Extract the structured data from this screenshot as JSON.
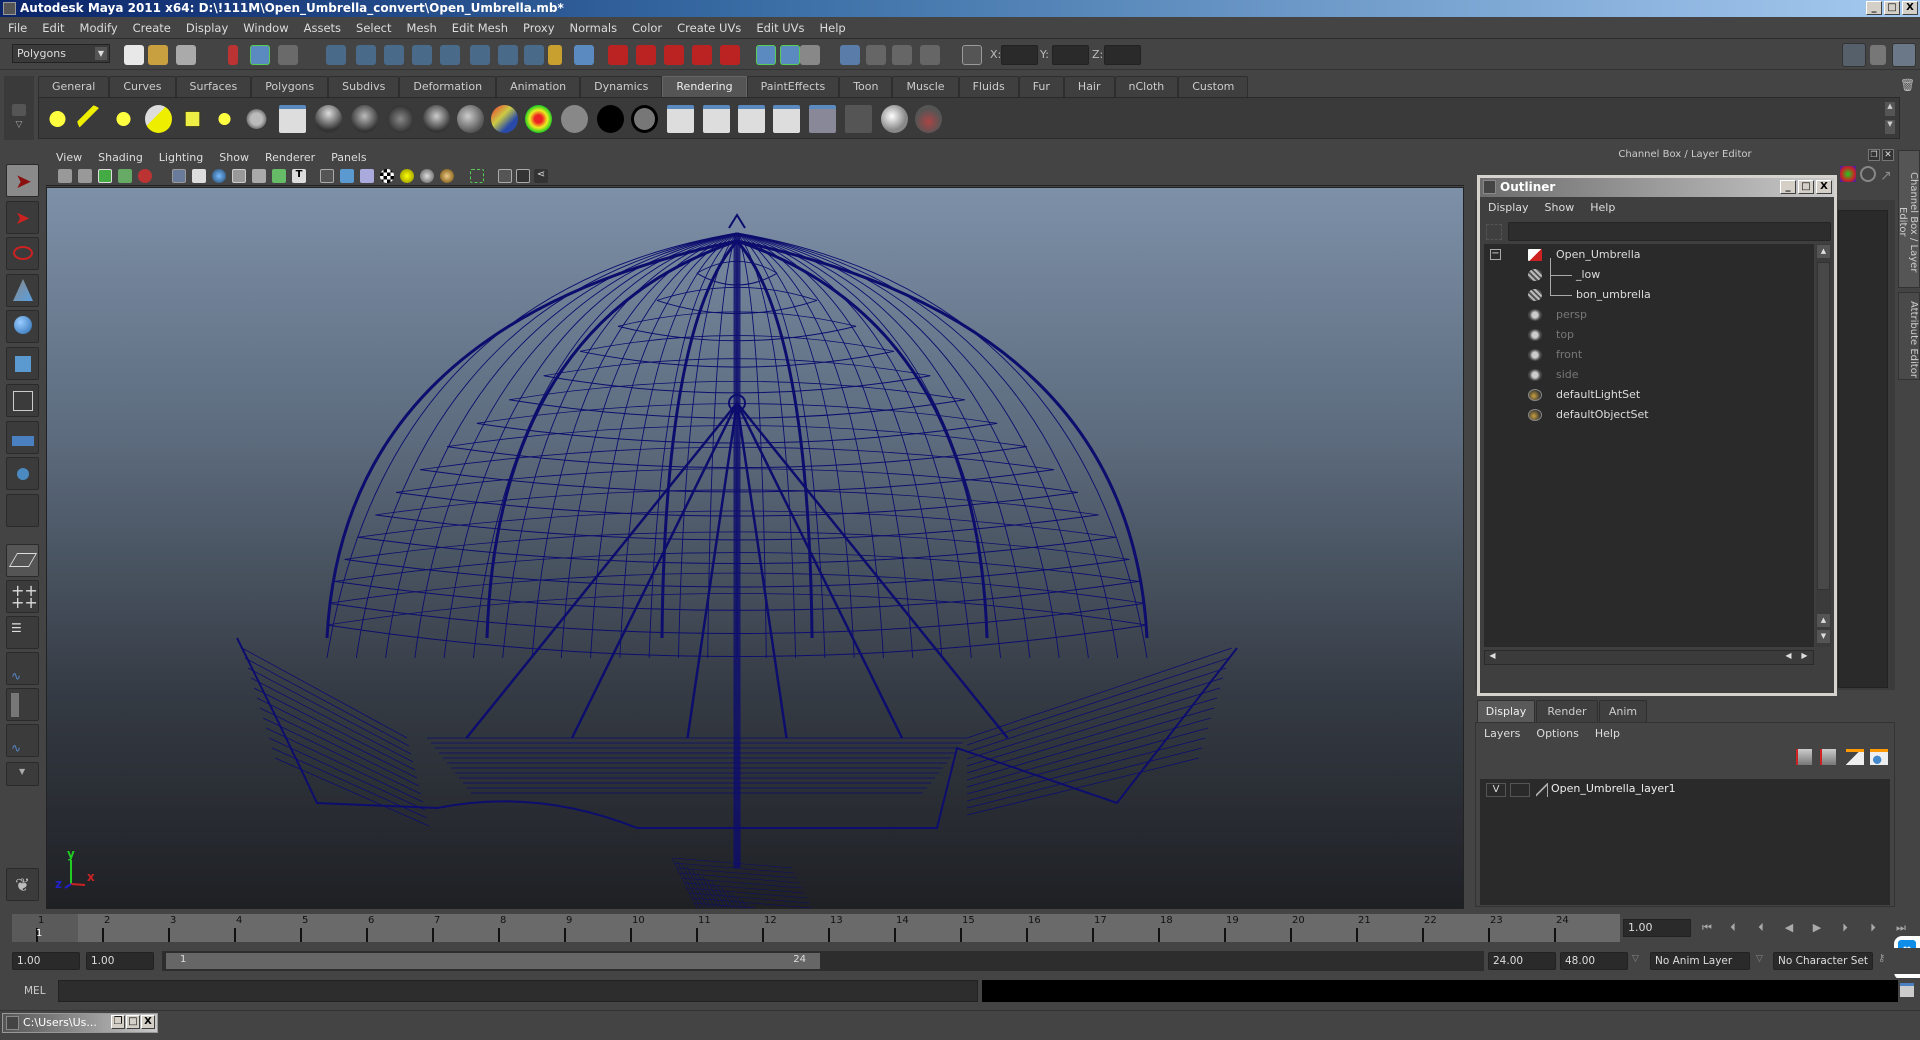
{
  "window": {
    "title": "Autodesk Maya 2011 x64: D:\\!111M\\Open_Umbrella_convert\\Open_Umbrella.mb*",
    "controls": [
      "_",
      "□",
      "X"
    ]
  },
  "menubar": [
    "File",
    "Edit",
    "Modify",
    "Create",
    "Display",
    "Window",
    "Assets",
    "Select",
    "Mesh",
    "Edit Mesh",
    "Proxy",
    "Normals",
    "Color",
    "Create UVs",
    "Edit UVs",
    "Help"
  ],
  "statusline": {
    "menuset": "Polygons",
    "x_label": "X:",
    "y_label": "Y:",
    "z_label": "Z:",
    "x_value": "",
    "y_value": "",
    "z_value": ""
  },
  "shelf": {
    "tabs": [
      "General",
      "Curves",
      "Surfaces",
      "Polygons",
      "Subdivs",
      "Deformation",
      "Animation",
      "Dynamics",
      "Rendering",
      "PaintEffects",
      "Toon",
      "Muscle",
      "Fluids",
      "Fur",
      "Hair",
      "nCloth",
      "Custom"
    ],
    "active_tab": "Rendering",
    "icons": [
      "ambient-light",
      "directional-light",
      "point-light",
      "spot-light",
      "area-light",
      "volume-light",
      "camera",
      "lambert-material",
      "blinn-material",
      "phong-material",
      "phonge-material",
      "anisotropic-material",
      "layered-shader",
      "ramp-shader",
      "surface-shader",
      "use-background",
      "shading-map",
      "render-current-frame",
      "ipr-render",
      "batch-render",
      "render-settings",
      "hypershade",
      "render-view",
      "mental-ray",
      "paint-effects-brush"
    ]
  },
  "viewport": {
    "menu": [
      "View",
      "Shading",
      "Lighting",
      "Show",
      "Renderer",
      "Panels"
    ],
    "axis": {
      "x": "x",
      "y": "y",
      "z": "z"
    },
    "wire_color": "#0d0d6e"
  },
  "channelbox": {
    "title": "Channel Box / Layer Editor",
    "side_tabs": [
      "Channel Box / Layer Editor",
      "Attribute Editor"
    ]
  },
  "outliner": {
    "title": "Outliner",
    "menu": [
      "Display",
      "Show",
      "Help"
    ],
    "filter_value": "",
    "items": [
      {
        "label": "Open_Umbrella",
        "icon": "transform-icon",
        "level": 0,
        "dim": false,
        "expanded": true
      },
      {
        "label": "_low",
        "icon": "mesh-icon",
        "level": 1,
        "dim": false
      },
      {
        "label": "bon_umbrella",
        "icon": "mesh-icon",
        "level": 1,
        "dim": false
      },
      {
        "label": "persp",
        "icon": "camera-icon",
        "level": 0,
        "dim": true
      },
      {
        "label": "top",
        "icon": "camera-icon",
        "level": 0,
        "dim": true
      },
      {
        "label": "front",
        "icon": "camera-icon",
        "level": 0,
        "dim": true
      },
      {
        "label": "side",
        "icon": "camera-icon",
        "level": 0,
        "dim": true
      },
      {
        "label": "defaultLightSet",
        "icon": "set-icon",
        "level": 0,
        "dim": false
      },
      {
        "label": "defaultObjectSet",
        "icon": "set-icon",
        "level": 0,
        "dim": false
      }
    ]
  },
  "layereditor": {
    "tabs": [
      "Display",
      "Render",
      "Anim"
    ],
    "active_tab": "Display",
    "menu": [
      "Layers",
      "Options",
      "Help"
    ],
    "layers": [
      {
        "visible": "V",
        "name": "Open_Umbrella_layer1"
      }
    ]
  },
  "timeline": {
    "ticks": [
      "1",
      "2",
      "3",
      "4",
      "5",
      "6",
      "7",
      "8",
      "9",
      "10",
      "11",
      "12",
      "13",
      "14",
      "15",
      "16",
      "17",
      "18",
      "19",
      "20",
      "21",
      "22",
      "23",
      "24"
    ],
    "current_marker": "1",
    "current_frame": "1.00"
  },
  "range": {
    "start": "1.00",
    "anim_start": "1.00",
    "slider_start": "1",
    "slider_end": "24",
    "end": "24.00",
    "anim_end": "48.00",
    "anim_layer": "No Anim Layer",
    "character_set": "No Character Set"
  },
  "mel": {
    "label": "MEL",
    "value": ""
  },
  "taskbar": {
    "item": "C:\\Users\\Us..."
  }
}
